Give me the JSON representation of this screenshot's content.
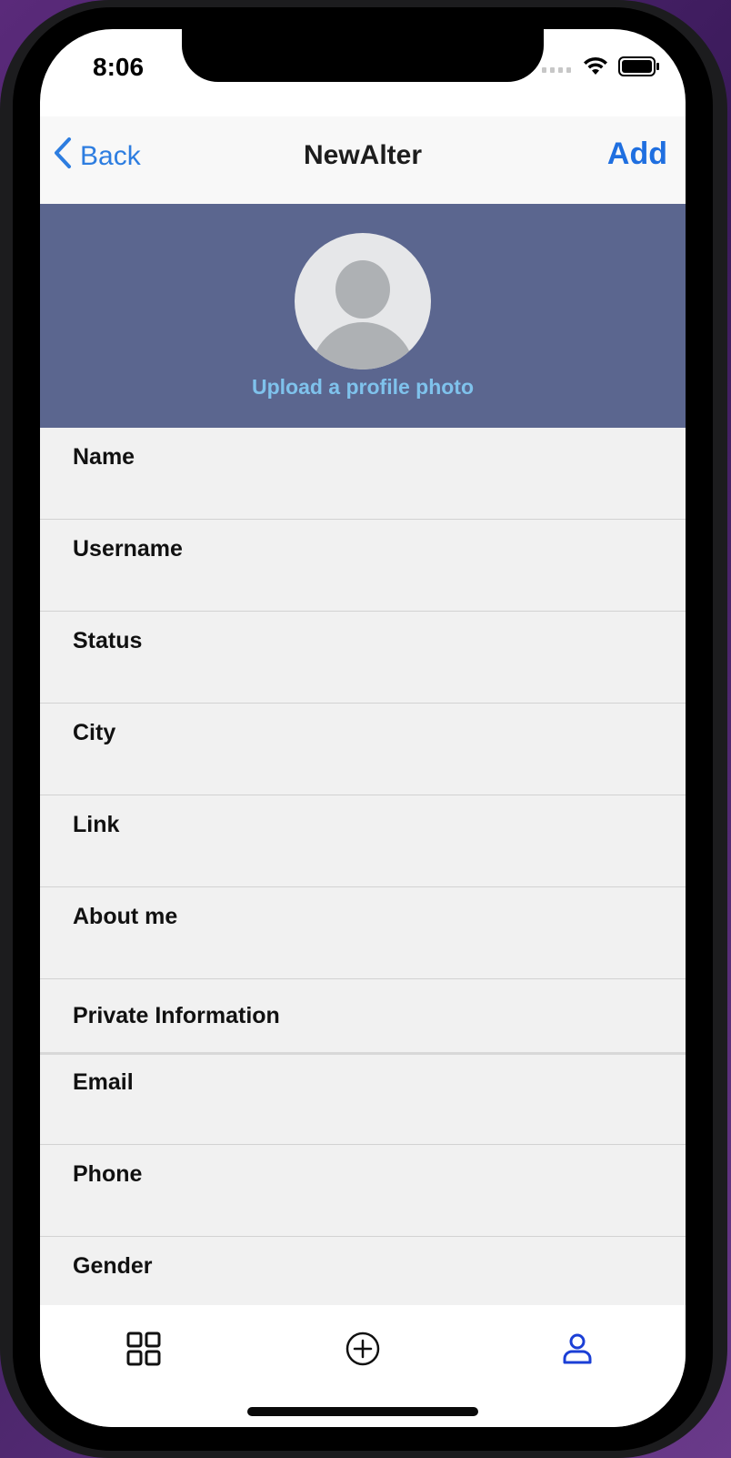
{
  "status_bar": {
    "time": "8:06"
  },
  "nav": {
    "back_label": "Back",
    "title": "NewAlter",
    "add_label": "Add"
  },
  "profile": {
    "upload_label": "Upload a profile photo"
  },
  "fields": [
    {
      "label": "Name"
    },
    {
      "label": "Username"
    },
    {
      "label": "Status"
    },
    {
      "label": "City"
    },
    {
      "label": "Link"
    },
    {
      "label": "About me"
    }
  ],
  "private_section": {
    "title": "Private Information"
  },
  "private_fields": [
    {
      "label": "Email"
    },
    {
      "label": "Phone"
    },
    {
      "label": "Gender"
    }
  ],
  "tabs": [
    {
      "icon": "grid-icon",
      "active": false
    },
    {
      "icon": "add-circle-icon",
      "active": false
    },
    {
      "icon": "profile-icon",
      "active": true
    }
  ],
  "colors": {
    "accent": "#1f6fe0",
    "back_link": "#2d7de0",
    "header_bg": "#5b668f",
    "upload_text": "#7fc2ec",
    "active_tab": "#1b3fd6"
  }
}
